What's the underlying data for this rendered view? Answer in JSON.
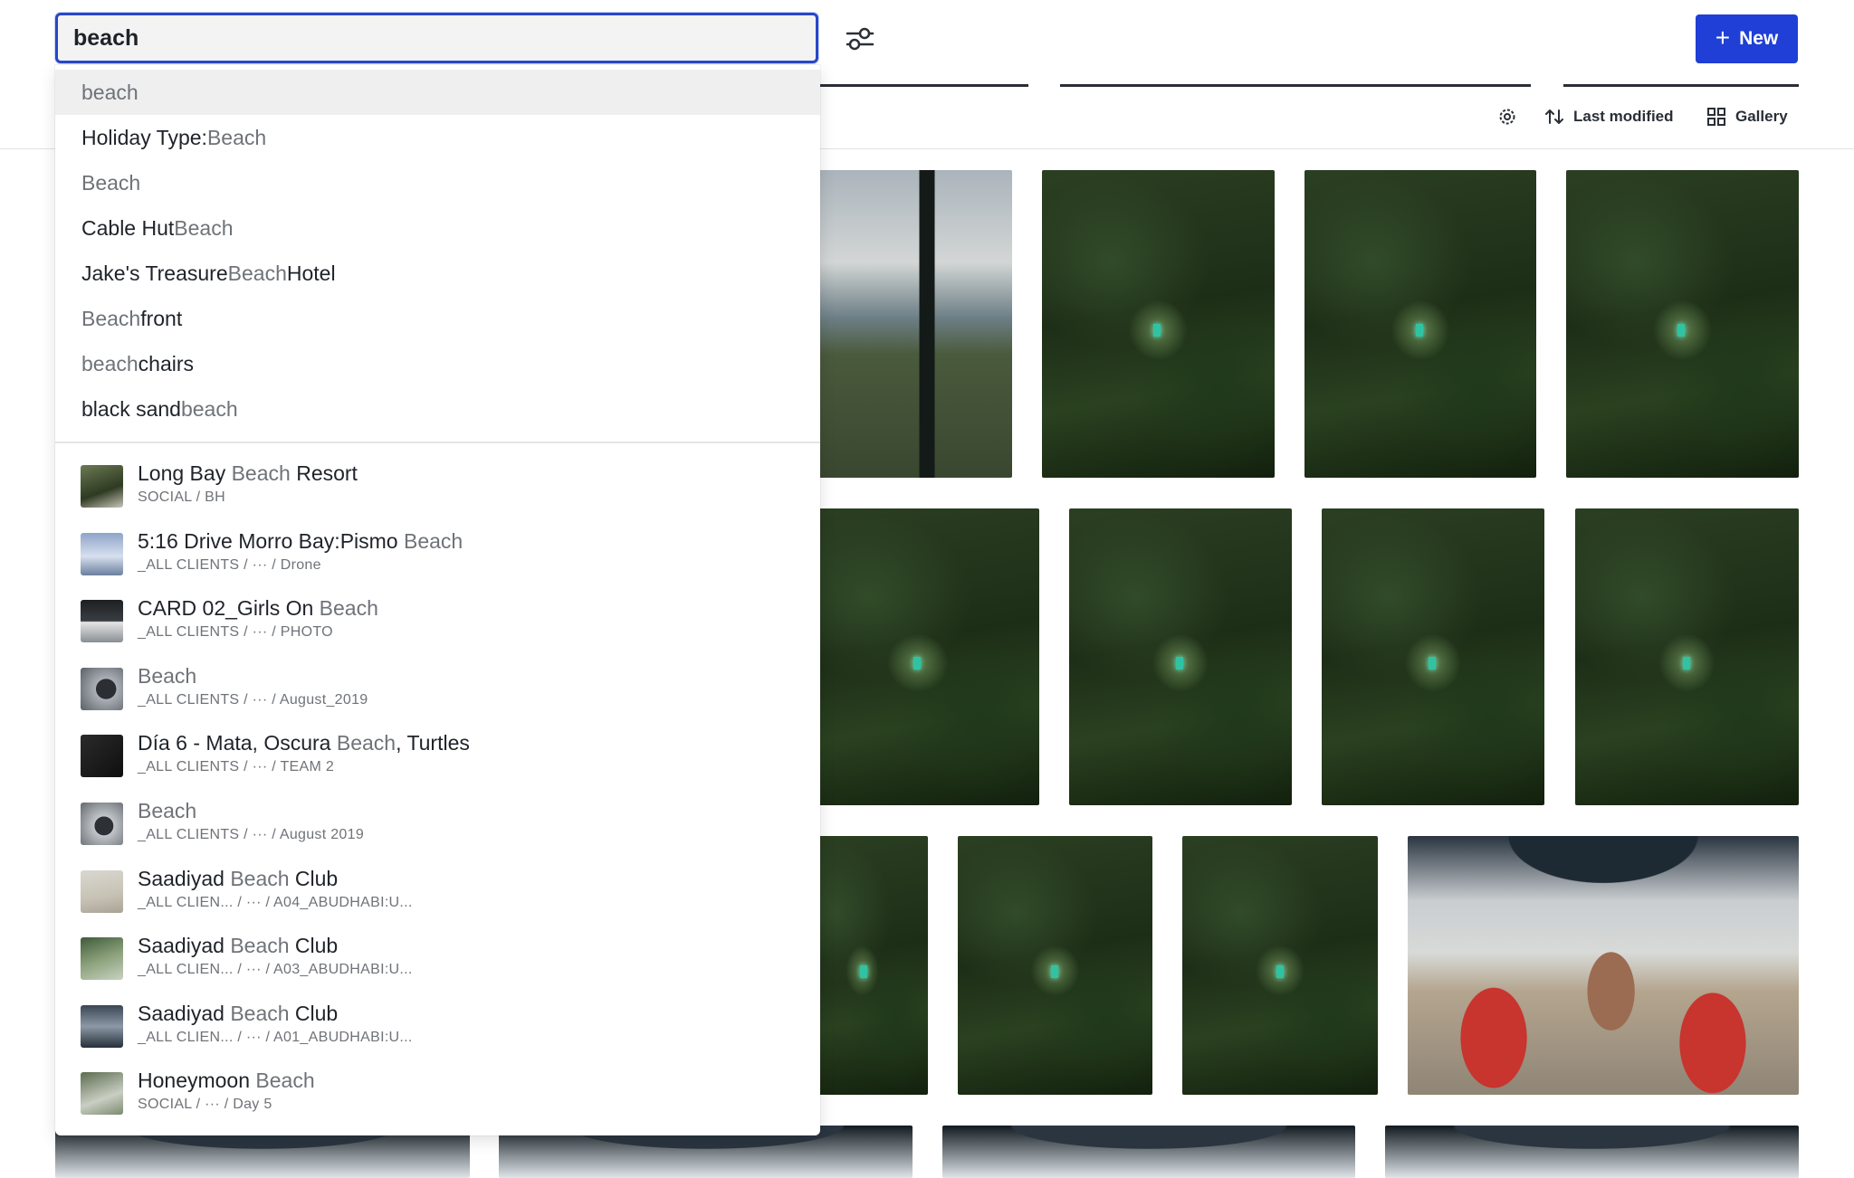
{
  "search": {
    "value": "beach"
  },
  "header": {
    "new_label": "New",
    "sort_label": "Last modified",
    "view_label": "Gallery"
  },
  "suggestions": [
    {
      "parts": [
        {
          "text": "beach",
          "dim": true
        }
      ]
    },
    {
      "parts": [
        {
          "text": "Holiday Type: ",
          "dim": false
        },
        {
          "text": "Beach",
          "dim": true
        }
      ]
    },
    {
      "parts": [
        {
          "text": "Beach",
          "dim": true
        }
      ]
    },
    {
      "parts": [
        {
          "text": "Cable Hut ",
          "dim": false
        },
        {
          "text": "Beach",
          "dim": true
        }
      ]
    },
    {
      "parts": [
        {
          "text": "Jake's Treasure ",
          "dim": false
        },
        {
          "text": "Beach",
          "dim": true
        },
        {
          "text": " Hotel",
          "dim": false
        }
      ]
    },
    {
      "parts": [
        {
          "text": "Beach",
          "dim": true
        },
        {
          "text": "front",
          "dim": false
        }
      ]
    },
    {
      "parts": [
        {
          "text": "beach",
          "dim": true
        },
        {
          "text": " chairs",
          "dim": false
        }
      ]
    },
    {
      "parts": [
        {
          "text": "black sand ",
          "dim": false
        },
        {
          "text": "beach",
          "dim": true
        }
      ]
    }
  ],
  "results": [
    {
      "parts": [
        {
          "text": "Long Bay ",
          "dim": false
        },
        {
          "text": "Beach",
          "dim": true
        },
        {
          "text": " Resort",
          "dim": false
        }
      ],
      "path": "SOCIAL / BH",
      "thumb": "t-forest"
    },
    {
      "parts": [
        {
          "text": "5:16 Drive Morro Bay:Pismo ",
          "dim": false
        },
        {
          "text": "Beach",
          "dim": true
        }
      ],
      "path": "_ALL CLIENTS / ··· / Drone",
      "thumb": "t-sky"
    },
    {
      "parts": [
        {
          "text": "CARD 02_Girls On ",
          "dim": false
        },
        {
          "text": "Beach",
          "dim": true
        }
      ],
      "path": "_ALL CLIENTS / ··· / PHOTO",
      "thumb": "t-girl"
    },
    {
      "parts": [
        {
          "text": "Beach",
          "dim": true
        }
      ],
      "path": "_ALL CLIENTS / ··· / August_2019",
      "thumb": "t-beach1"
    },
    {
      "parts": [
        {
          "text": "Día 6 - Mata, Oscura ",
          "dim": false
        },
        {
          "text": "Beach",
          "dim": true
        },
        {
          "text": ", Turtles",
          "dim": false
        }
      ],
      "path": "_ALL CLIENTS / ··· / TEAM 2",
      "thumb": "t-dark"
    },
    {
      "parts": [
        {
          "text": "Beach",
          "dim": true
        }
      ],
      "path": "_ALL CLIENTS / ··· / August 2019",
      "thumb": "t-beach2"
    },
    {
      "parts": [
        {
          "text": "Saadiyad ",
          "dim": false
        },
        {
          "text": "Beach",
          "dim": true
        },
        {
          "text": " Club",
          "dim": false
        }
      ],
      "path": "_ALL CLIEN...  / ··· / A04_ABUDHABI:U...",
      "thumb": "t-sand"
    },
    {
      "parts": [
        {
          "text": "Saadiyad ",
          "dim": false
        },
        {
          "text": "Beach",
          "dim": true
        },
        {
          "text": " Club",
          "dim": false
        }
      ],
      "path": "_ALL CLIEN...  / ··· / A03_ABUDHABI:U...",
      "thumb": "t-palm"
    },
    {
      "parts": [
        {
          "text": "Saadiyad ",
          "dim": false
        },
        {
          "text": "Beach",
          "dim": true
        },
        {
          "text": " Club",
          "dim": false
        }
      ],
      "path": "_ALL CLIEN...  / ··· / A01_ABUDHABI:U...",
      "thumb": "t-boat"
    },
    {
      "parts": [
        {
          "text": "Honeymoon ",
          "dim": false
        },
        {
          "text": "Beach",
          "dim": true
        }
      ],
      "path": "SOCIAL / ··· / Day 5",
      "thumb": "t-honey"
    }
  ],
  "gallery": {
    "row1": [
      "window-view",
      "jungle",
      "jungle",
      "jungle"
    ],
    "row2": [
      "jungle",
      "jungle",
      "jungle",
      "jungle"
    ],
    "row3": [
      "jungle",
      "jungle",
      "jungle",
      "boat"
    ],
    "row4": [
      "boat-top",
      "boat-top",
      "boat-top",
      "boat-top"
    ]
  },
  "icons": {
    "filter": "sliders-icon",
    "new": "plus-icon",
    "settings": "gear-icon",
    "sort": "sort-arrows-icon",
    "view": "grid-icon"
  },
  "colors": {
    "accent": "#1f3fd6",
    "focus_border": "#2947c9"
  }
}
